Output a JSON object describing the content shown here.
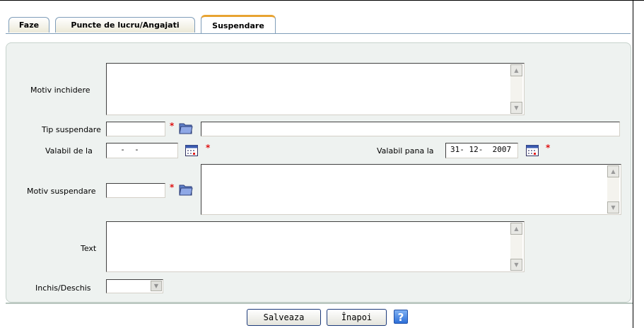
{
  "tabs": [
    {
      "label": "Faze"
    },
    {
      "label": "Puncte de lucru/Angajati"
    },
    {
      "label": "Suspendare"
    }
  ],
  "form": {
    "motiv_inchidere_label": "Motiv inchidere",
    "motiv_inchidere_value": "",
    "tip_suspendare_label": "Tip suspendare",
    "tip_suspendare_code": "",
    "tip_suspendare_desc": "",
    "valabil_de_la_label": "Valabil de la",
    "valabil_de_la_value": "  -  -",
    "valabil_pana_la_label": "Valabil pana la",
    "valabil_pana_la_value": "31- 12-  2007",
    "motiv_suspendare_label": "Motiv suspendare",
    "motiv_suspendare_code": "",
    "motiv_suspendare_text": "",
    "text_label": "Text",
    "text_value": "",
    "inchis_deschis_label": "Inchis/Deschis",
    "inchis_deschis_value": "",
    "required_marker": "*"
  },
  "buttons": {
    "save_label": "Salveaza",
    "back_label": "Înapoi",
    "help_label": "?"
  },
  "colors": {
    "active_tab_accent": "#e8a331",
    "panel_bg": "#eef2f0",
    "required": "#e01010",
    "button_border": "#1c3a7a"
  },
  "icons": {
    "lookup": "folder-icon",
    "calendar": "calendar-icon",
    "help": "help-icon"
  }
}
